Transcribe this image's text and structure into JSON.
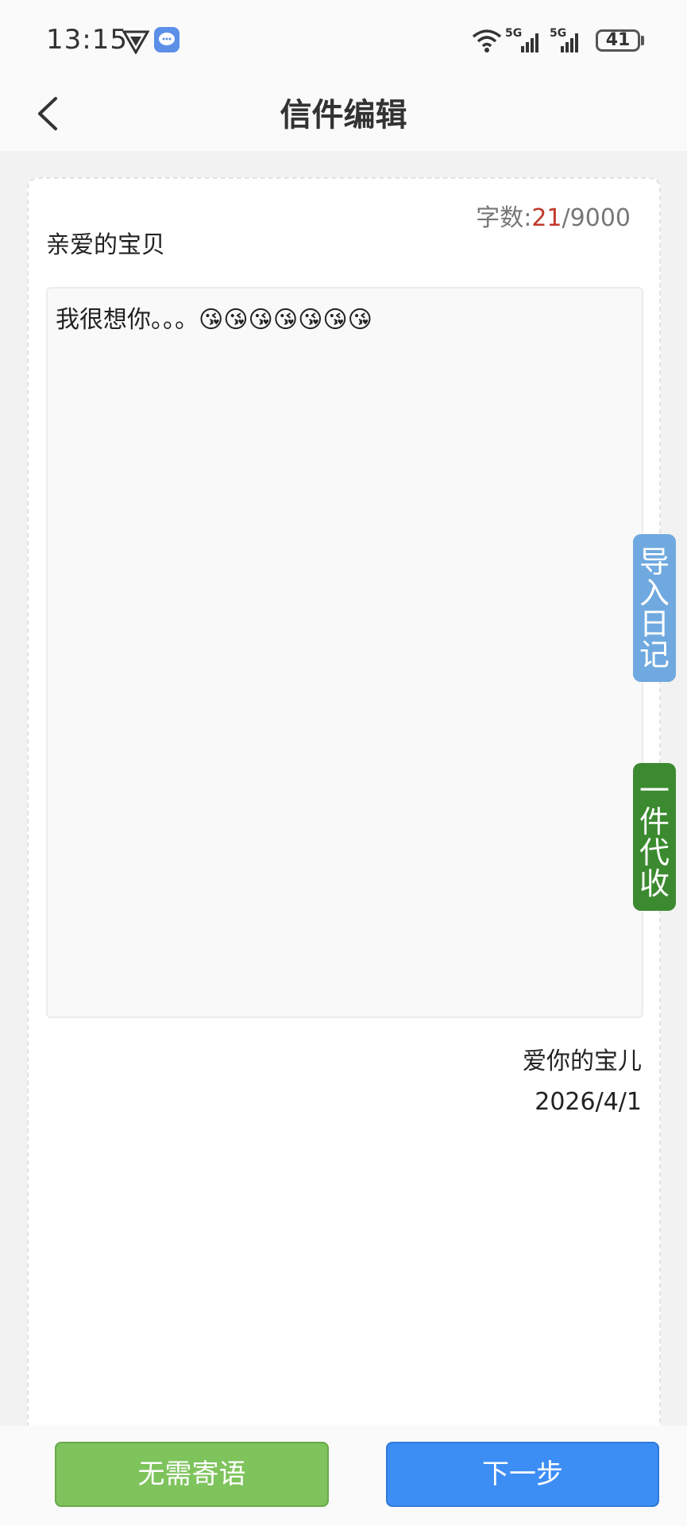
{
  "status_bar": {
    "time": "13:15",
    "icons": [
      "vpn-icon",
      "message-icon",
      "wifi-icon",
      "signal-5g-icon",
      "signal-5g-icon"
    ],
    "signal_label_1": "5G",
    "signal_label_2": "5G",
    "battery": "41"
  },
  "nav": {
    "title": "信件编辑",
    "back_icon": "chevron-left-icon"
  },
  "editor": {
    "word_count_label": "字数:",
    "word_count_current": "21",
    "word_count_max": "/9000",
    "salutation": "亲爱的宝贝",
    "body": "我很想你。。。😘😘😘😘😘😘😘",
    "signature": "爱你的宝儿",
    "date": "2026/4/1"
  },
  "side_tabs": {
    "import_diary": "导\n入\n日\n记",
    "one_click_collect": "一\n件\n代\n收"
  },
  "buttons": {
    "skip": "无需寄语",
    "next": "下一步"
  },
  "colors": {
    "accent_blue": "#3d8ef4",
    "accent_green": "#7ec35c",
    "tab_blue": "#6fa9df",
    "tab_green": "#3c8a30",
    "count_red": "#c0392b"
  }
}
